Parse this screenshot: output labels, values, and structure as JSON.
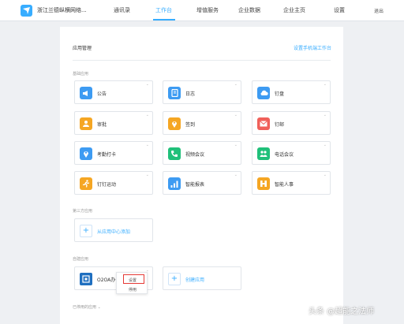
{
  "header": {
    "company": "浙江兰德纵横网络...",
    "nav": [
      {
        "label": "通讯录"
      },
      {
        "label": "工作台"
      },
      {
        "label": "增值服务"
      },
      {
        "label": "企业数据"
      },
      {
        "label": "企业主页"
      },
      {
        "label": "设置"
      }
    ],
    "active_nav": "工作台",
    "logout": "退出"
  },
  "panel": {
    "title": "应用管理",
    "settings_link": "设置手机端工作台"
  },
  "sections": {
    "builtin": "基础应用",
    "third_party": "第三方应用",
    "self_built": "自建应用",
    "disabled": "已停用的应用 ⌄"
  },
  "apps": [
    {
      "name": "公告",
      "icon": "megaphone-icon",
      "color": "#3d9bf2"
    },
    {
      "name": "日志",
      "icon": "log-icon",
      "color": "#3d9bf2"
    },
    {
      "name": "钉盘",
      "icon": "cloud-icon",
      "color": "#3d9bf2"
    },
    {
      "name": "审批",
      "icon": "approval-icon",
      "color": "#f5a623"
    },
    {
      "name": "签到",
      "icon": "location-pin-icon",
      "color": "#f5a623"
    },
    {
      "name": "钉邮",
      "icon": "mail-icon",
      "color": "#f0605a"
    },
    {
      "name": "考勤打卡",
      "icon": "clock-in-icon",
      "color": "#3d9bf2"
    },
    {
      "name": "视频会议",
      "icon": "video-call-icon",
      "color": "#20c07a"
    },
    {
      "name": "电话会议",
      "icon": "phone-conference-icon",
      "color": "#20c07a"
    },
    {
      "name": "钉钉运动",
      "icon": "runner-icon",
      "color": "#f5a623"
    },
    {
      "name": "智能报表",
      "icon": "bar-chart-icon",
      "color": "#3d9bf2"
    },
    {
      "name": "智能人事",
      "icon": "hr-icon",
      "color": "#f5a623"
    }
  ],
  "third_party_add": "从应用中心添加",
  "custom_app": {
    "name": "O2OA办公",
    "icon": "app-logo-icon",
    "color": "#1f6fc0"
  },
  "create_app": "创建应用",
  "dropdown": {
    "set": "设置",
    "disable": "停用"
  },
  "watermark": "头条 @超能之法师"
}
